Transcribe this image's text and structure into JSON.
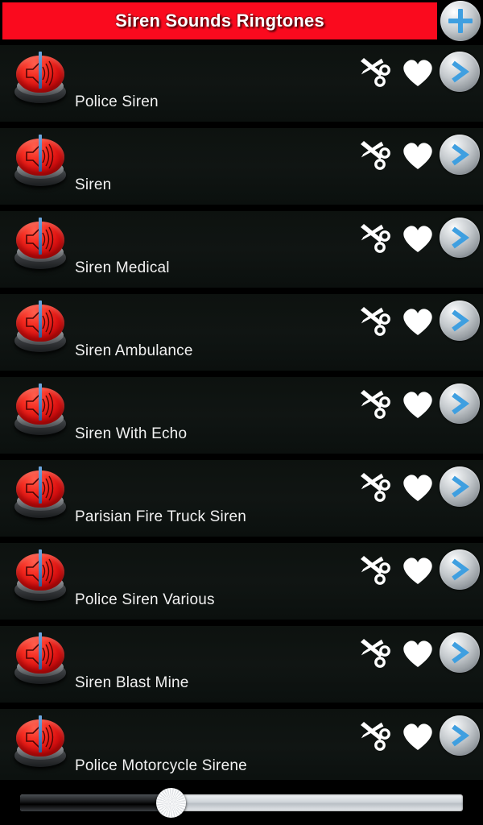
{
  "header": {
    "title": "Siren Sounds Ringtones",
    "add_button_label": "+",
    "accent_red": "#FA0A1E",
    "accent_blue": "#3F9FE0"
  },
  "list": {
    "items": [
      {
        "title": "Police Siren"
      },
      {
        "title": "Siren"
      },
      {
        "title": "Siren Medical"
      },
      {
        "title": "Siren Ambulance"
      },
      {
        "title": "Siren With Echo"
      },
      {
        "title": "Parisian Fire Truck Siren"
      },
      {
        "title": "Police Siren Various"
      },
      {
        "title": "Siren Blast Mine"
      },
      {
        "title": "Police Motorcycle Sirene"
      }
    ],
    "row_icons": {
      "play": "red-dome-speaker-icon",
      "cut": "scissors-icon",
      "favorite": "heart-icon",
      "open": "chevron-right-icon"
    }
  },
  "seekbar": {
    "progress_percent": 34,
    "thumb_label": "seek-thumb"
  }
}
